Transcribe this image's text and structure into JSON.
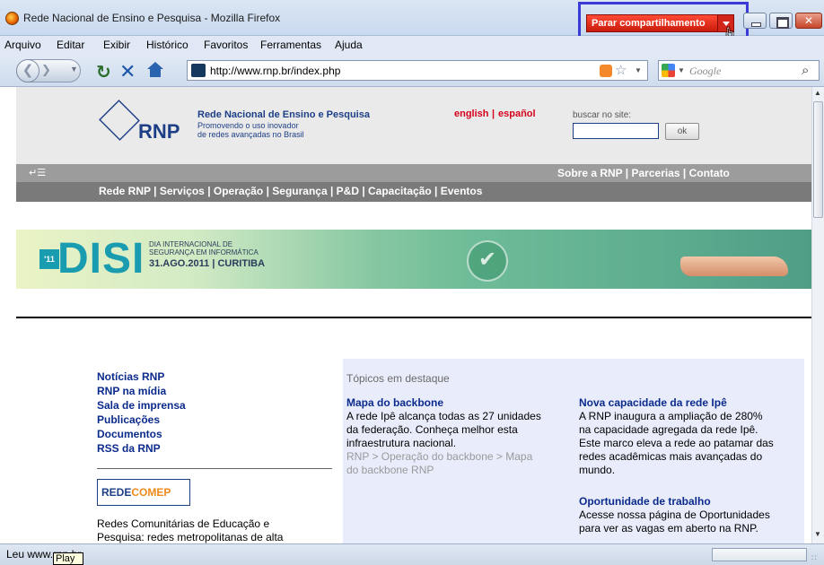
{
  "window": {
    "title": "Rede Nacional de Ensino e Pesquisa - Mozilla Firefox",
    "share_button": "Parar compartilhamento"
  },
  "menubar": [
    "Arquivo",
    "Editar",
    "Exibir",
    "Histórico",
    "Favoritos",
    "Ferramentas",
    "Ajuda"
  ],
  "navbar": {
    "url": "http://www.rnp.br/index.php",
    "search_engine": "Google",
    "search_placeholder": "Google"
  },
  "header": {
    "logo_text": "RNP",
    "org_name": "Rede Nacional de Ensino e Pesquisa",
    "tagline_1": "Promovendo o uso inovador",
    "tagline_2": "de redes avançadas no Brasil",
    "lang_english": "english",
    "lang_sep": "|",
    "lang_spanish": "español",
    "search_label": "buscar no site:",
    "search_button": "ok"
  },
  "topnav": {
    "links": "Sobre a RNP | Parcerias | Contato",
    "main_links": "Rede RNP | Serviços | Operação | Segurança | P&D | Capacitação | Eventos"
  },
  "banner": {
    "year_tag": "'11",
    "title": "DISI",
    "line1": "DIA INTERNACIONAL DE",
    "line2": "SEGURANÇA EM INFORMÁTICA",
    "line3": "31.AGO.2011 | CURITIBA"
  },
  "left_menu": [
    "Notícias RNP",
    "RNP na mídia",
    "Sala de imprensa",
    "Publicações",
    "Documentos",
    "RSS da RNP"
  ],
  "redecomep": {
    "logo_part1": "REDE",
    "logo_part2": "COMEP",
    "text_line1": "Redes Comunitárias de Educação e",
    "text_line2": "Pesquisa: redes metropolitanas de alta"
  },
  "topics": {
    "title": "Tópicos em destaque",
    "backbone": {
      "title": "Mapa do backbone",
      "lines": [
        "A rede Ipê alcança todas as 27 unidades",
        "da federação. Conheça melhor esta",
        "infraestrutura nacional."
      ],
      "crumb_lines": [
        "RNP > Operação do backbone > Mapa",
        "do backbone RNP"
      ]
    },
    "capacity": {
      "title": "Nova capacidade da rede Ipê",
      "lines": [
        "A RNP inaugura a ampliação de 280%",
        "na capacidade agregada da rede Ipê.",
        "Este marco eleva a rede ao patamar das",
        "redes acadêmicas mais avançadas do",
        "mundo."
      ]
    },
    "jobs": {
      "title": "Oportunidade de trabalho",
      "lines": [
        "Acesse nossa página de Oportunidades",
        "para ver as vagas em aberto na RNP."
      ]
    }
  },
  "status": {
    "text": "Leu www.rnp.br",
    "tooltip": "Play"
  }
}
